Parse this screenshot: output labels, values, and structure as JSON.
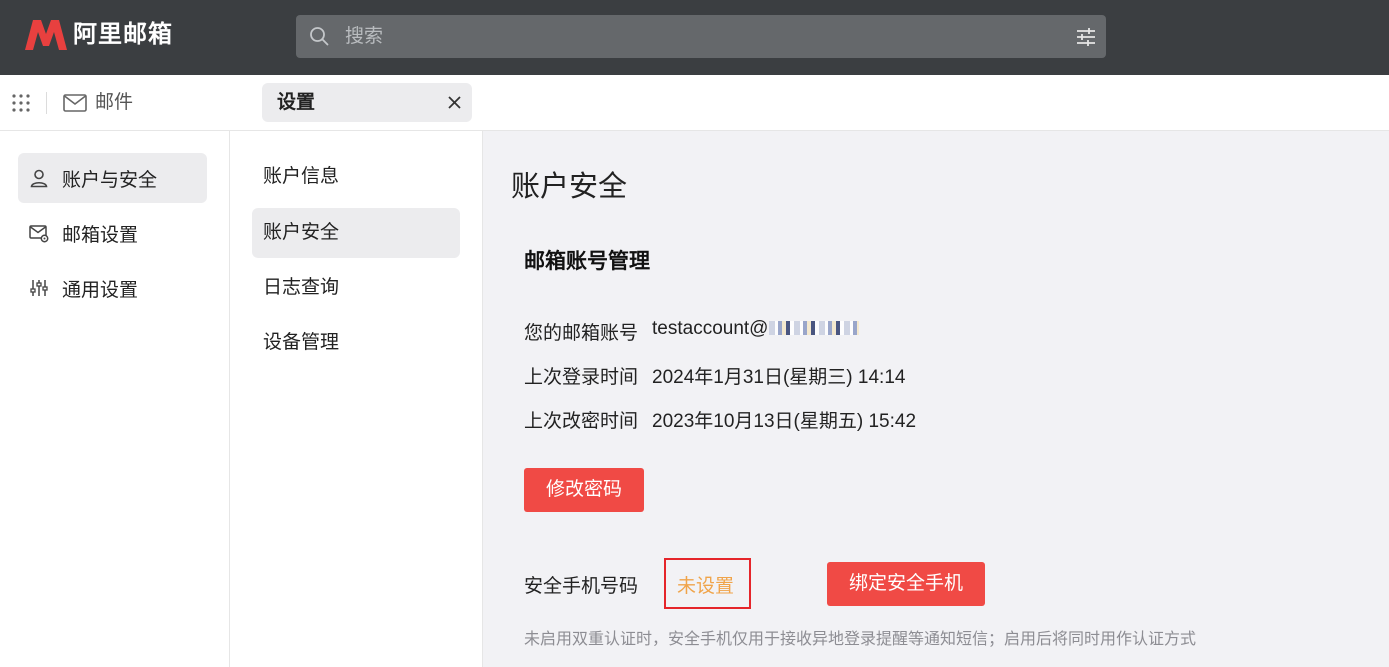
{
  "app": {
    "logo_text": "阿里邮箱",
    "brand_color": "#e8403f"
  },
  "search": {
    "placeholder": "搜索"
  },
  "nav": {
    "mail_label": "邮件",
    "tab_label": "设置"
  },
  "sidebar": {
    "items": [
      {
        "label": "账户与安全",
        "icon": "user-icon",
        "active": true
      },
      {
        "label": "邮箱设置",
        "icon": "mailbox-settings-icon",
        "active": false
      },
      {
        "label": "通用设置",
        "icon": "sliders-icon",
        "active": false
      }
    ]
  },
  "submenu": {
    "items": [
      {
        "label": "账户信息",
        "active": false
      },
      {
        "label": "账户安全",
        "active": true
      },
      {
        "label": "日志查询",
        "active": false
      },
      {
        "label": "设备管理",
        "active": false
      }
    ]
  },
  "main": {
    "title": "账户安全",
    "section_title": "邮箱账号管理",
    "account_label": "您的邮箱账号",
    "account_value": "testaccount@",
    "last_login_label": "上次登录时间",
    "last_login_value": "2024年1月31日(星期三) 14:14",
    "last_pwd_label": "上次改密时间",
    "last_pwd_value": "2023年10月13日(星期五) 15:42",
    "change_password_button": "修改密码",
    "phone_label": "安全手机号码",
    "phone_status": "未设置",
    "bind_phone_button": "绑定安全手机",
    "hint": "未启用双重认证时，安全手机仅用于接收异地登录提醒等通知短信；启用后将同时用作认证方式"
  },
  "colors": {
    "topbar": "#3b3e41",
    "button_red": "#f04a45",
    "status_orange": "#f0a44a",
    "highlight_red": "#e5252a"
  }
}
